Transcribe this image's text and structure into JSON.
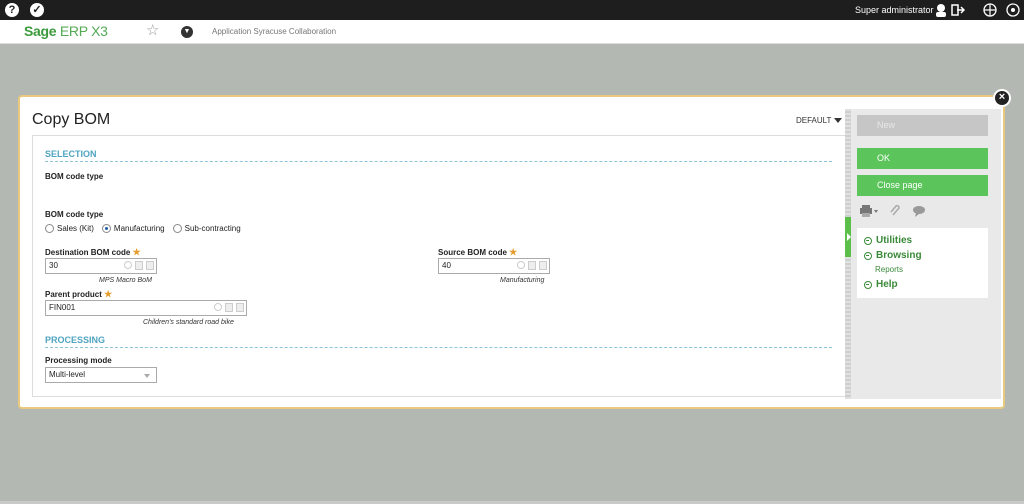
{
  "topbar": {
    "user": "Super administrator"
  },
  "header": {
    "logo_main": "Sage",
    "logo_suffix": "ERP X3",
    "app_name": "Application Syracuse Collaboration"
  },
  "page": {
    "title": "Copy BOM",
    "view": "DEFAULT"
  },
  "selection": {
    "section_title": "SELECTION",
    "bom_code_type_heading": "BOM code type",
    "bom_code_type_label": "BOM code type",
    "radios": [
      {
        "label": "Sales (Kit)",
        "checked": false
      },
      {
        "label": "Manufacturing",
        "checked": true
      },
      {
        "label": "Sub-contracting",
        "checked": false
      }
    ],
    "destination": {
      "label": "Destination BOM code",
      "value": "30",
      "hint": "MPS Macro BoM"
    },
    "source": {
      "label": "Source BOM code",
      "value": "40",
      "hint": "Manufacturing"
    },
    "parent": {
      "label": "Parent product",
      "value": "FIN001",
      "hint": "Children's standard road bike"
    }
  },
  "processing": {
    "section_title": "PROCESSING",
    "mode_label": "Processing mode",
    "mode_value": "Multi-level"
  },
  "side_panel": {
    "new_label": "New",
    "ok_label": "OK",
    "close_label": "Close page",
    "menu": {
      "utilities": "Utilities",
      "browsing": "Browsing",
      "reports": "Reports",
      "help": "Help"
    }
  },
  "colors": {
    "accent_green": "#5bc55b",
    "section_blue": "#4fa4c0",
    "required_star": "#e69d2d",
    "logo_green": "#3c9a3c"
  }
}
